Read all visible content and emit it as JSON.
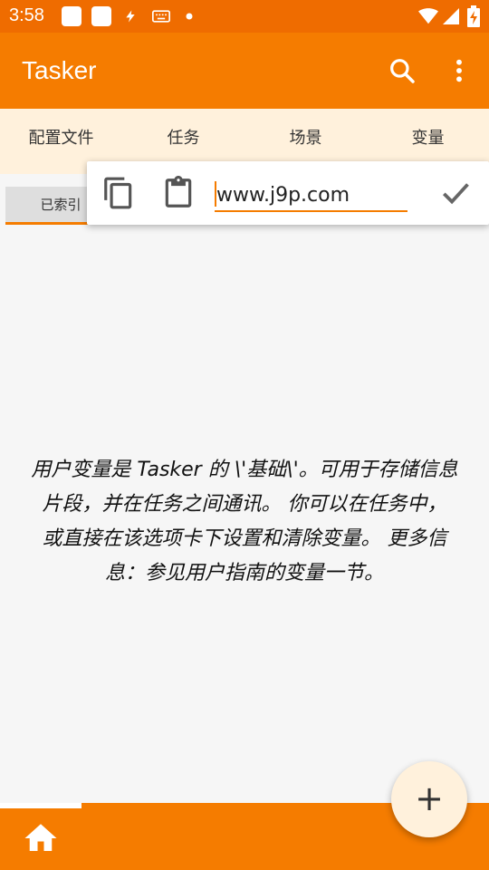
{
  "status_bar": {
    "time": "3:58",
    "icons": [
      "notification-square-icon",
      "notification-square-icon",
      "flash-icon",
      "keyboard-icon",
      "dot-icon",
      "wifi-icon",
      "signal-icon",
      "battery-charging-icon"
    ]
  },
  "app_bar": {
    "title": "Tasker",
    "actions": [
      "search-icon",
      "more-vert-icon"
    ]
  },
  "tabs": [
    {
      "label": "配置文件"
    },
    {
      "label": "任务"
    },
    {
      "label": "场景"
    },
    {
      "label": "变量"
    }
  ],
  "subtabs": [
    {
      "label": "已索引"
    },
    {
      "label": ""
    },
    {
      "label": ""
    },
    {
      "label": ""
    }
  ],
  "text_popup": {
    "value": "www.j9p.com",
    "actions": [
      "copy-icon",
      "paste-icon",
      "check-icon"
    ]
  },
  "help_text": {
    "lines": [
      "用户变量是 Tasker 的 \\'基础\\'。可用于存储信息",
      "片段，并在任务之间通讯。 你可以在任务中，",
      "或直接在该选项卡下设置和清除变量。 更多信",
      "息：参见用户指南的变量一节。"
    ]
  },
  "fab": {
    "label": "+"
  },
  "colors": {
    "primary": "#f57c00",
    "status": "#ef6c00",
    "tab_bg": "#fff1dc"
  }
}
